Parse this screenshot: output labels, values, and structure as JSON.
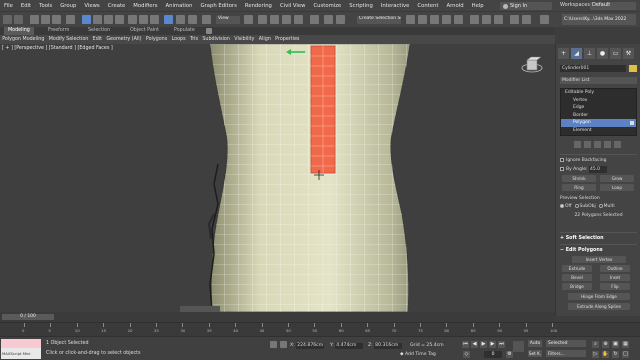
{
  "menu": [
    "File",
    "Edit",
    "Tools",
    "Group",
    "Views",
    "Create",
    "Modifiers",
    "Animation",
    "Graph Editors",
    "Rendering",
    "Civil View",
    "Customize",
    "Scripting",
    "Interactive",
    "Content",
    "Arnold",
    "Help"
  ],
  "account": {
    "signin": "Sign In",
    "workspaces_label": "Workspaces:",
    "workspace": "Default"
  },
  "toolbar": {
    "view_dropdown": "View",
    "selection_set": "Create Selection Set",
    "project_path": "C:\\Users\\Ky...\\3ds Max 2022"
  },
  "ribbon": {
    "tabs": [
      "Modeling",
      "Freeform",
      "Selection",
      "Object Paint",
      "Populate"
    ],
    "active_tab": "Modeling",
    "sub_items": [
      "Polygon Modeling",
      "Modify Selection",
      "Edit",
      "Geometry (All)",
      "Polygons",
      "Loops",
      "Tris",
      "Subdivision",
      "Visibility",
      "Align",
      "Properties"
    ]
  },
  "viewport": {
    "label": "[ + ] [Perspective ] [Standard ] [Edged Faces ]"
  },
  "command_panel": {
    "object_name": "Cylinder001",
    "modifier_list": "Modifier List",
    "stack": [
      {
        "label": "Editable Poly",
        "level": "top"
      },
      {
        "label": "Vertex",
        "level": "sub"
      },
      {
        "label": "Edge",
        "level": "sub"
      },
      {
        "label": "Border",
        "level": "sub"
      },
      {
        "label": "Polygon",
        "level": "sub",
        "selected": true
      },
      {
        "label": "Element",
        "level": "sub"
      }
    ],
    "ignore_backfacing": "Ignore Backfacing",
    "by_angle": "By Angle:",
    "by_angle_value": "45.0",
    "shrink": "Shrink",
    "grow": "Grow",
    "ring": "Ring",
    "loop": "Loop",
    "preview_selection": "Preview Selection",
    "preview_off": "Off",
    "preview_subobj": "SubObj",
    "preview_multi": "Multi",
    "selection_info": "22 Polygons Selected",
    "soft_selection": "Soft Selection",
    "edit_polygons": "Edit Polygons",
    "insert_vertex": "Insert Vertex",
    "extrude": "Extrude",
    "outline": "Outline",
    "bevel": "Bevel",
    "inset": "Inset",
    "bridge": "Bridge",
    "flip": "Flip",
    "hinge_from_edge": "Hinge From Edge",
    "extrude_along_spline": "Extrude Along Spline"
  },
  "timeline": {
    "slider_text": "0 / 100",
    "ticks": [
      "0",
      "5",
      "10",
      "15",
      "20",
      "25",
      "30",
      "35",
      "40",
      "45",
      "50",
      "55",
      "60",
      "65",
      "70",
      "75",
      "80",
      "85",
      "90",
      "95",
      "100"
    ]
  },
  "status": {
    "maxscript_label": "MAXScript Mini",
    "object_selected": "1 Object Selected",
    "hint": "Click or click-and-drag to select objects",
    "x_label": "X:",
    "x_value": "224.876cm",
    "y_label": "Y:",
    "y_value": "4.474cm",
    "z_label": "Z:",
    "z_value": "80.316cm",
    "grid": "Grid = 25.4cm",
    "add_time_tag": "Add Time Tag",
    "auto": "Auto",
    "set_k": "Set K.",
    "selected": "Selected",
    "filters": "Filters...",
    "frame": "0"
  }
}
